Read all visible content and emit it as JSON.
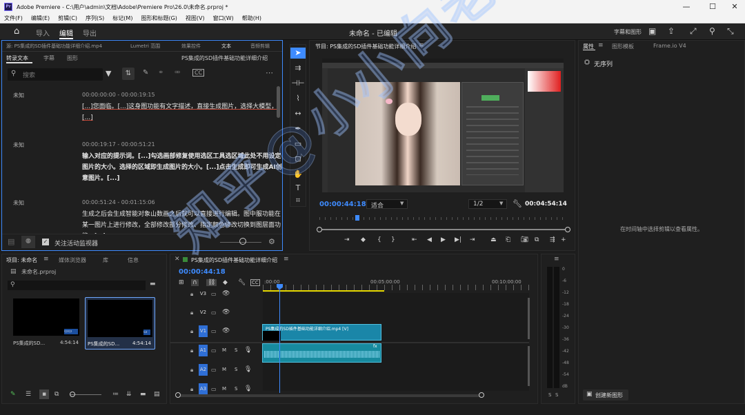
{
  "window": {
    "title": "Adobe Premiere - C:\\用户\\admin\\文档\\Adobe\\Premiere Pro\\26.0\\未命名.prproj *",
    "app_icon": "Pr",
    "minimize": "—",
    "maximize": "☐",
    "close": "✕"
  },
  "menu": [
    "文件(F)",
    "编辑(E)",
    "剪辑(C)",
    "序列(S)",
    "标记(M)",
    "图形和标题(G)",
    "视图(V)",
    "窗口(W)",
    "帮助(H)"
  ],
  "workspace": {
    "tabs": [
      "导入",
      "编辑",
      "导出"
    ],
    "active": "编辑",
    "project_title": "未命名 - 已编辑",
    "captions_link": "字幕和图形"
  },
  "source_panel": {
    "tabs": [
      "源: PS集成的SD插件基础功能详细介绍.mp4",
      "Lumetri 范围",
      "效果控件",
      "文本",
      "音频剪辑"
    ],
    "subtabs": [
      "转录文本",
      "字幕",
      "图形"
    ],
    "sequence_name": "PS集成的SD插件基础功能详细介绍",
    "search_placeholder": "搜索",
    "segments": [
      {
        "speaker": "未知",
        "time": "00:00:00:00 - 00:00:19:15",
        "text": "[...]您面临。[...]这身图功能有文字描述，直接生成图片，选择大模型，[...]"
      },
      {
        "speaker": "未知",
        "time": "00:00:19:17 - 00:00:51:21",
        "text": "输入对应的提示词。[...]勾选画部修复使用选区工具选区域此处不用设定图片的大小。选择的区域即生成图片的大小。[...]点击生成即可生成AI创意图片。[...]"
      },
      {
        "speaker": "未知",
        "time": "00:00:51:24 - 00:01:15:06",
        "text": "生成之后会生成智能对象山数画之后就可以直接进行编辑。图中服功能在某一图片上进行修改，全部修改部分修改、指定颜色修改切换到图层面功能，[...]"
      }
    ],
    "follow_monitor": "关注活动监视器"
  },
  "program_panel": {
    "title": "节目: PS集成的SD插件基础功能详细介绍",
    "timecode": "00:00:44:18",
    "fit": "适合",
    "resolution": "1/2",
    "duration": "00:04:54:14"
  },
  "properties_panel": {
    "tabs": [
      "属性",
      "图形模板",
      "Frame.io V4"
    ],
    "no_sequence": "无序列",
    "hint": "在时间轴中选择剪辑以查看属性。",
    "create_graphic": "创建新图形"
  },
  "project_panel": {
    "tabs": [
      "项目: 未命名",
      "媒体浏览器",
      "库",
      "信息"
    ],
    "file": "未命名.prproj",
    "items": [
      {
        "name": "PS集成的SD...",
        "duration": "4:54:14"
      },
      {
        "name": "PS集成的SD...",
        "duration": "4:54:14"
      }
    ]
  },
  "timeline_panel": {
    "title": "PS集成的SD插件基础功能详细介绍",
    "timecode": "00:00:44:18",
    "ruler": [
      ":00:00",
      "00:05:00:00",
      "00:10:00:00"
    ],
    "tracks": [
      {
        "id": "V3",
        "type": "video"
      },
      {
        "id": "V2",
        "type": "video"
      },
      {
        "id": "V1",
        "type": "video",
        "clip": "PS集成的SD插件基础功能详细介绍.mp4 [V]"
      },
      {
        "id": "A1",
        "type": "audio",
        "m": "M",
        "s": "S"
      },
      {
        "id": "A2",
        "type": "audio",
        "m": "M",
        "s": "S"
      },
      {
        "id": "A3",
        "type": "audio",
        "m": "M",
        "s": "S"
      }
    ]
  },
  "audio_meter": {
    "scale": [
      "0",
      "-6",
      "-12",
      "-18",
      "-24",
      "-30",
      "-36",
      "-42",
      "-48",
      "-54",
      "dB"
    ],
    "solo": [
      "S",
      "S"
    ]
  },
  "watermark": "知乎@小小向老师",
  "colors": {
    "accent": "#3e8bff",
    "clip_blue": "#1a86a8",
    "playhead": "#3e8bff"
  }
}
